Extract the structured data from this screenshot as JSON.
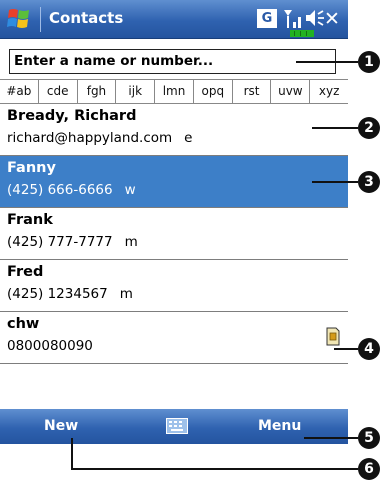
{
  "titlebar": {
    "title": "Contacts",
    "g_label": "G",
    "close_label": "✕"
  },
  "search": {
    "value": "Enter a name or number..."
  },
  "alpha_tabs": [
    "#ab",
    "cde",
    "fgh",
    "ijk",
    "lmn",
    "opq",
    "rst",
    "uvw",
    "xyz"
  ],
  "contacts": [
    {
      "name": "Bready, Richard",
      "detail": "richard@happyland.com",
      "type": "e",
      "selected": false
    },
    {
      "name": "Fanny",
      "detail": "(425) 666-6666",
      "type": "w",
      "selected": true
    },
    {
      "name": "Frank",
      "detail": "(425) 777-7777",
      "type": "m",
      "selected": false
    },
    {
      "name": "Fred",
      "detail": "(425) 1234567",
      "type": "m",
      "selected": false
    },
    {
      "name": "chw",
      "detail": "0800080090",
      "type": "",
      "selected": false
    }
  ],
  "menubar": {
    "left_label": "New",
    "right_label": "Menu"
  },
  "callouts": [
    "1",
    "2",
    "3",
    "4",
    "5",
    "6"
  ],
  "colors": {
    "titlebar": "#2f62b0",
    "selected_row": "#3d7fc8",
    "callout": "#111111"
  }
}
